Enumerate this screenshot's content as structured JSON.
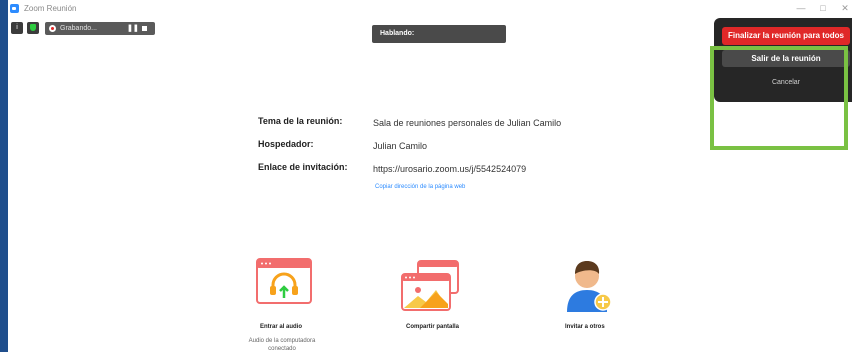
{
  "window": {
    "title": "Zoom Reunión"
  },
  "toolbar": {
    "recording_label": "Grabando..."
  },
  "speaking": {
    "label": "Hablando:"
  },
  "meeting_info": {
    "topic_label": "Tema de la reunión:",
    "topic_value": "Sala de reuniones personales de Julian Camilo",
    "host_label": "Hospedador:",
    "host_value": "Julian Camilo",
    "invite_label": "Enlace de invitación:",
    "invite_value": "https://urosario.zoom.us/j/5542524079",
    "copy_link": "Copiar dirección de la página web"
  },
  "actions": [
    {
      "label": "Entrar al audio",
      "sub1": "Audio de la computadora",
      "sub2": "conectado"
    },
    {
      "label": "Compartir pantalla"
    },
    {
      "label": "Invitar a otros"
    }
  ],
  "end_menu": {
    "end_all": "Finalizar la reunión para todos",
    "leave": "Salir de la reunión",
    "cancel": "Cancelar"
  },
  "colors": {
    "accent_red": "#e02828",
    "zoom_blue": "#2d8cff",
    "highlight_green": "#7ac143",
    "menu_bg": "#262626"
  }
}
